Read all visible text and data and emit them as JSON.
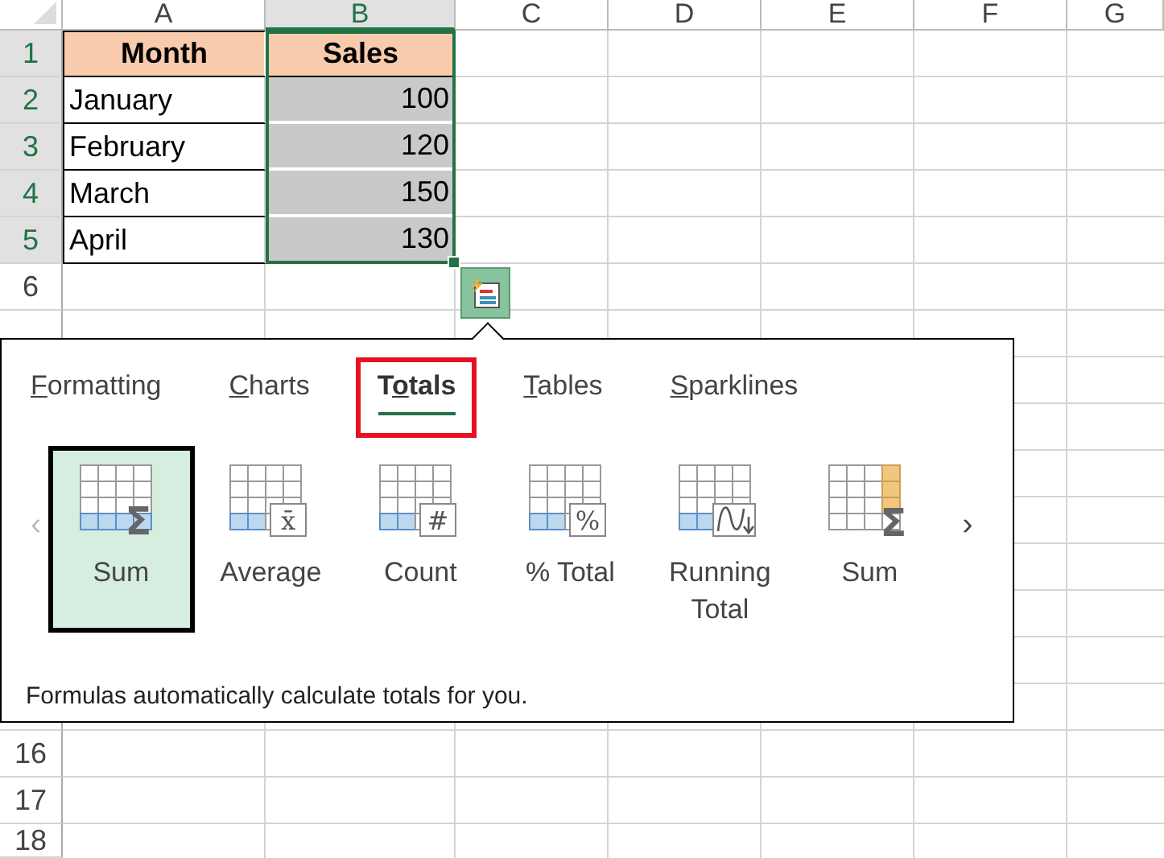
{
  "sheet": {
    "column_headers": [
      {
        "label": "A",
        "selected": false
      },
      {
        "label": "B",
        "selected": true
      },
      {
        "label": "C",
        "selected": false
      },
      {
        "label": "D",
        "selected": false
      },
      {
        "label": "E",
        "selected": false
      },
      {
        "label": "F",
        "selected": false
      },
      {
        "label": "G",
        "selected": false
      }
    ],
    "rows_top": [
      {
        "label": "1",
        "selected": true
      },
      {
        "label": "2",
        "selected": true
      },
      {
        "label": "3",
        "selected": true
      },
      {
        "label": "4",
        "selected": true
      },
      {
        "label": "5",
        "selected": true
      },
      {
        "label": "6",
        "selected": false
      }
    ],
    "rows_bottom": [
      {
        "label": "16",
        "selected": false
      },
      {
        "label": "17",
        "selected": false
      },
      {
        "label": "18",
        "selected": false
      }
    ]
  },
  "table": {
    "columns": [
      {
        "label": "Month",
        "selected": false
      },
      {
        "label": "Sales",
        "selected": true
      }
    ],
    "rows": [
      [
        "January",
        "100"
      ],
      [
        "February",
        "120"
      ],
      [
        "March",
        "150"
      ],
      [
        "April",
        "130"
      ]
    ]
  },
  "quick_analysis": {
    "tabs": [
      {
        "key": "F",
        "rest": "ormatting",
        "selected": false,
        "annotated": false
      },
      {
        "key": "C",
        "rest": "harts",
        "selected": false,
        "annotated": false
      },
      {
        "pre": "T",
        "key": "o",
        "rest": "tals",
        "selected": true,
        "annotated": true
      },
      {
        "key": "T",
        "rest": "ables",
        "selected": false,
        "annotated": false
      },
      {
        "key": "S",
        "rest": "parklines",
        "selected": false,
        "annotated": false
      }
    ],
    "prev": {
      "label": "‹",
      "disabled": true
    },
    "next": {
      "label": "›",
      "disabled": false
    },
    "items": [
      {
        "label": "Sum",
        "kind": "sum-row",
        "symbol": "Σ",
        "selected": true
      },
      {
        "label": "Average",
        "kind": "boxed",
        "symbol": "x̄",
        "selected": false
      },
      {
        "label": "Count",
        "kind": "boxed",
        "symbol": "#",
        "selected": false
      },
      {
        "label": "% Total",
        "kind": "boxed",
        "symbol": "%",
        "selected": false
      },
      {
        "label": "Running Total",
        "kind": "running",
        "selected": false
      },
      {
        "label": "Sum",
        "kind": "sum-column",
        "symbol": "Σ",
        "selected": false
      }
    ],
    "description": "Formulas automatically calculate totals for you."
  }
}
